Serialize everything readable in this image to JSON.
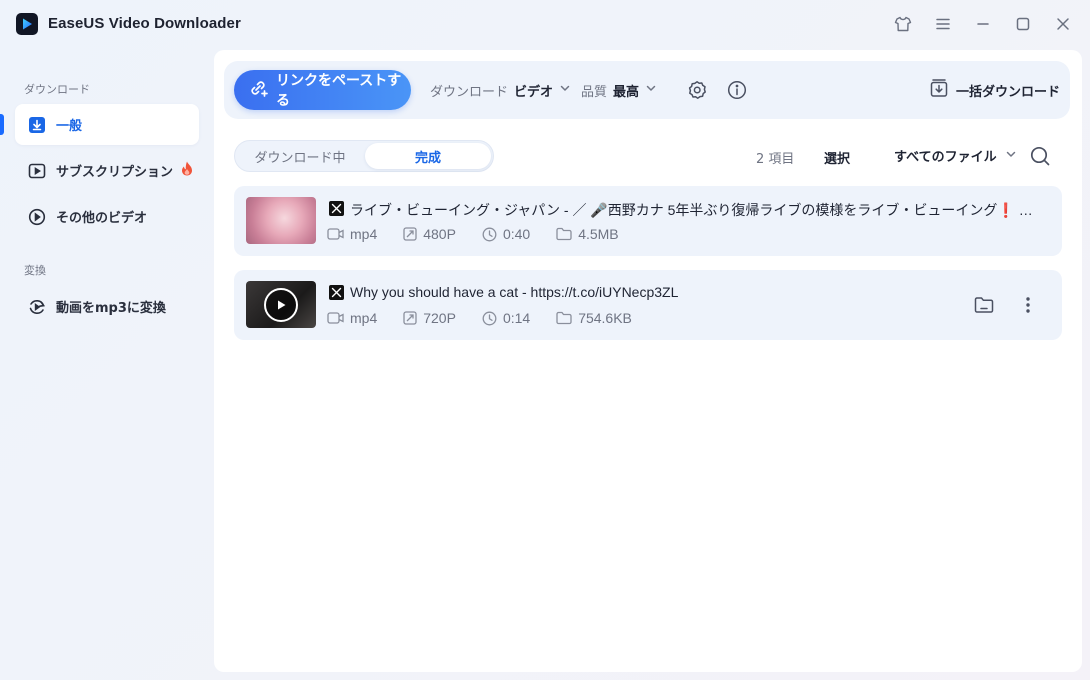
{
  "app": {
    "title": "EaseUS Video Downloader"
  },
  "sidebar": {
    "section_download": "ダウンロード",
    "section_convert": "変換",
    "items": [
      {
        "label": "一般"
      },
      {
        "label": "サブスクリプション"
      },
      {
        "label": "その他のビデオ"
      },
      {
        "label": "動画をmp3に変換"
      }
    ]
  },
  "toolbar": {
    "paste_label": "リンクをペーストする",
    "download_key": "ダウンロード",
    "download_value": "ビデオ",
    "quality_key": "品質",
    "quality_value": "最高",
    "batch_label": "一括ダウンロード"
  },
  "tabs": {
    "downloading": "ダウンロード中",
    "completed": "完成"
  },
  "list_header": {
    "count": "2 項目",
    "select": "選択",
    "filter": "すべてのファイル"
  },
  "items": [
    {
      "title": "ライブ・ビューイング・ジャパン - ／ 🎤西野カナ 5年半ぶり復帰ライブの模様をライブ・ビューイング❗ ＼ 🎈プレオーダー（抽選）受付中",
      "format": "mp4",
      "resolution": "480P",
      "duration": "0:40",
      "size": "4.5MB"
    },
    {
      "title": "Why you should have a cat - https://t.co/iUYNecp3ZL",
      "format": "mp4",
      "resolution": "720P",
      "duration": "0:14",
      "size": "754.6KB"
    }
  ],
  "colors": {
    "accent": "#1a6bff",
    "paste_gradient_start": "#3a6ff0",
    "paste_gradient_end": "#4a95f7",
    "row_bg": "#eef3fb",
    "fire": "#f0543a"
  },
  "icons": {
    "shirt": "tshirt-icon",
    "menu": "hamburger-icon",
    "minimize": "minimize-icon",
    "maximize": "maximize-icon",
    "close": "close-icon"
  }
}
